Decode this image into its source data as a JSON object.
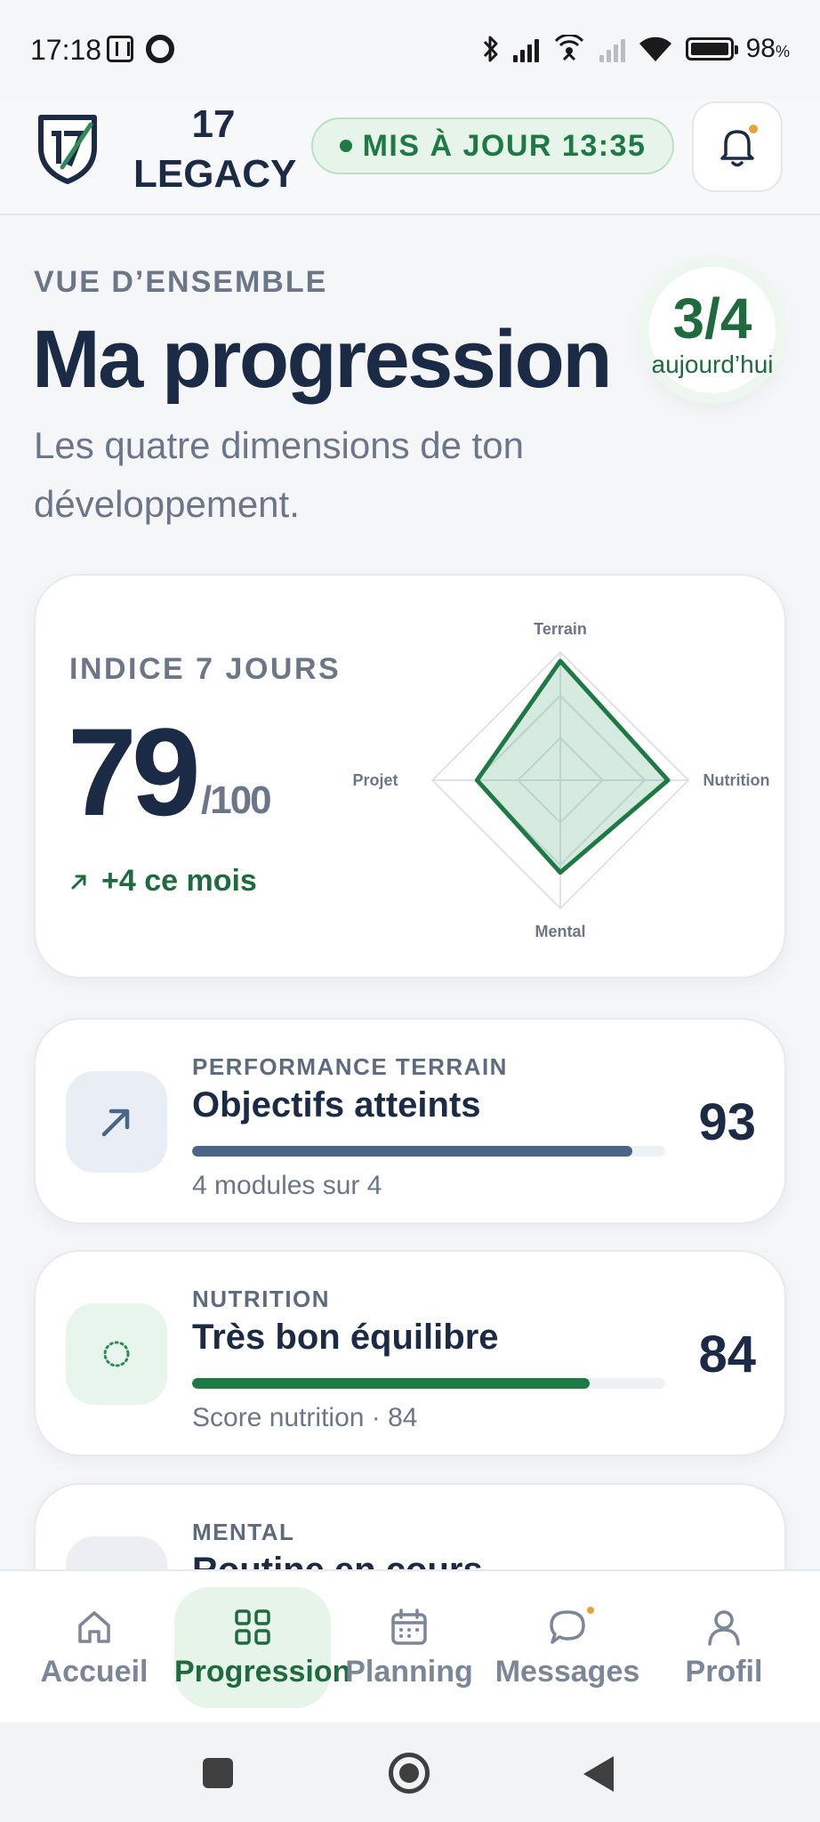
{
  "status_bar": {
    "time": "17:18",
    "battery": "98",
    "battery_unit": "%"
  },
  "header": {
    "brand_line1": "17",
    "brand_line2": "LEGACY",
    "update_label": "MIS À JOUR 13:35",
    "accent_color": "#1e7a45",
    "notification_dot_color": "#e9a23b"
  },
  "overview": {
    "eyebrow": "VUE D’ENSEMBLE",
    "title": "Ma progression",
    "subtitle": "Les quatre dimensions de ton développement.",
    "today_value": "3/4",
    "today_label": "aujourd’hui"
  },
  "index_card": {
    "eyebrow": "INDICE 7 JOURS",
    "score": "79",
    "max": "/100",
    "trend": "+4 ce mois",
    "radar_axes": [
      "Terrain",
      "Nutrition",
      "Mental",
      "Projet"
    ],
    "radar_values": [
      0.93,
      0.84,
      0.72,
      0.65
    ]
  },
  "metrics": [
    {
      "eyebrow": "PERFORMANCE TERRAIN",
      "title": "Objectifs atteints",
      "subtitle": "4 modules sur 4",
      "score": "93",
      "progress": 0.93,
      "bar_color": "#4a6588",
      "icon": "trend-up-icon"
    },
    {
      "eyebrow": "NUTRITION",
      "title": "Très bon équilibre",
      "subtitle": "Score nutrition · 84",
      "score": "84",
      "progress": 0.84,
      "bar_color": "#1e7a45",
      "icon": "dotted-circle-icon"
    },
    {
      "eyebrow": "MENTAL",
      "title": "Routine en cours"
    }
  ],
  "bottom_nav": {
    "items": [
      {
        "label": "Accueil",
        "icon": "home-icon"
      },
      {
        "label": "Progression",
        "icon": "grid-icon"
      },
      {
        "label": "Planning",
        "icon": "calendar-icon"
      },
      {
        "label": "Messages",
        "icon": "chat-icon"
      },
      {
        "label": "Profil",
        "icon": "user-icon"
      }
    ],
    "active": "Progression"
  }
}
